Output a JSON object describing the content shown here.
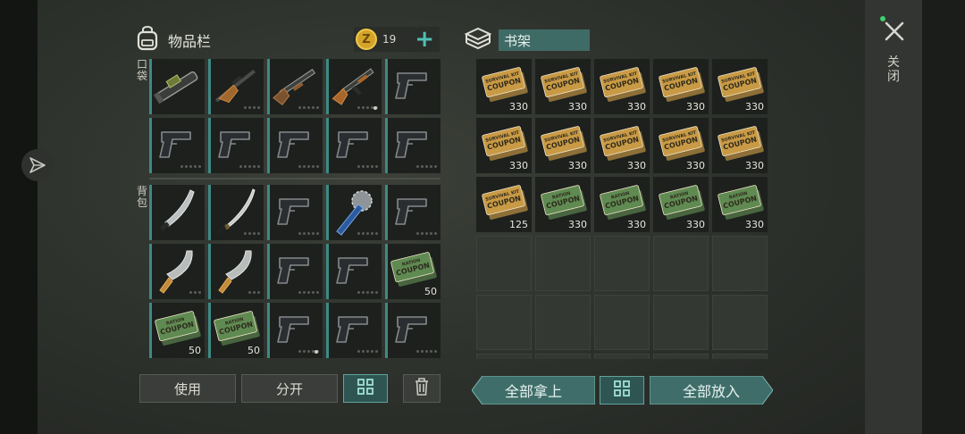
{
  "header": {
    "inventory_title": "物品栏",
    "coin_amount": "19",
    "coin_symbol": "Z",
    "shelf_name": "书架"
  },
  "labels": {
    "pocket": "口袋",
    "backpack": "背包",
    "close": "关闭"
  },
  "pocket_slots": [
    {
      "item": "rocket-launcher",
      "dots": 0,
      "on": 0
    },
    {
      "item": "hunting-rifle",
      "dots": 4,
      "on": 0
    },
    {
      "item": "shotgun",
      "dots": 5,
      "on": 0
    },
    {
      "item": "ak-rifle",
      "dots": 5,
      "on": 0,
      "mark": true
    },
    {
      "item": "pistol",
      "dots": 0,
      "on": 0
    },
    {
      "item": "pistol",
      "dots": 5,
      "on": 0
    },
    {
      "item": "pistol",
      "dots": 5,
      "on": 0
    },
    {
      "item": "pistol",
      "dots": 5,
      "on": 0
    },
    {
      "item": "pistol",
      "dots": 5,
      "on": 0
    },
    {
      "item": "pistol",
      "dots": 5,
      "on": 0
    }
  ],
  "backpack_slots": [
    {
      "item": "machete",
      "dots": 0,
      "on": 0
    },
    {
      "item": "katana",
      "dots": 4,
      "on": 0
    },
    {
      "item": "pistol",
      "dots": 5,
      "on": 0
    },
    {
      "item": "saw-mace",
      "dots": 5,
      "on": 0
    },
    {
      "item": "pistol",
      "dots": 5,
      "on": 0
    },
    {
      "item": "cleaver",
      "dots": 3,
      "on": 0
    },
    {
      "item": "cleaver",
      "dots": 3,
      "on": 0
    },
    {
      "item": "pistol",
      "dots": 5,
      "on": 0
    },
    {
      "item": "pistol",
      "dots": 5,
      "on": 0
    },
    {
      "item": "ration-coupon",
      "count": "50"
    },
    {
      "item": "ration-coupon",
      "count": "50"
    },
    {
      "item": "ration-coupon",
      "count": "50"
    },
    {
      "item": "pistol",
      "dots": 5,
      "on": 0,
      "mark": true
    },
    {
      "item": "pistol",
      "dots": 5,
      "on": 0
    },
    {
      "item": "pistol",
      "dots": 5,
      "on": 0
    }
  ],
  "shelf_slots": [
    {
      "item": "survival-coupon",
      "count": "330"
    },
    {
      "item": "survival-coupon",
      "count": "330"
    },
    {
      "item": "survival-coupon",
      "count": "330"
    },
    {
      "item": "survival-coupon",
      "count": "330"
    },
    {
      "item": "survival-coupon",
      "count": "330"
    },
    {
      "item": "survival-coupon",
      "count": "330"
    },
    {
      "item": "survival-coupon",
      "count": "330"
    },
    {
      "item": "survival-coupon",
      "count": "330"
    },
    {
      "item": "survival-coupon",
      "count": "330"
    },
    {
      "item": "survival-coupon",
      "count": "330"
    },
    {
      "item": "survival-coupon",
      "count": "125"
    },
    {
      "item": "ration-coupon",
      "count": "330"
    },
    {
      "item": "ration-coupon",
      "count": "330"
    },
    {
      "item": "ration-coupon",
      "count": "330"
    },
    {
      "item": "ration-coupon",
      "count": "330"
    },
    {},
    {},
    {},
    {},
    {},
    {},
    {},
    {},
    {},
    {},
    {},
    {},
    {},
    {},
    {}
  ],
  "coupon_text": {
    "ration_top": "RATION",
    "ration_main": "COUPON",
    "survival_top": "SURVIVAL KIT",
    "survival_main": "COUPON"
  },
  "buttons": {
    "use": "使用",
    "split": "分开",
    "take_all": "全部拿上",
    "put_all": "全部放入"
  },
  "colors": {
    "accent_teal": "#3d8a85",
    "ration_green": "#5f8a52",
    "survival_gold": "#c99a45"
  }
}
